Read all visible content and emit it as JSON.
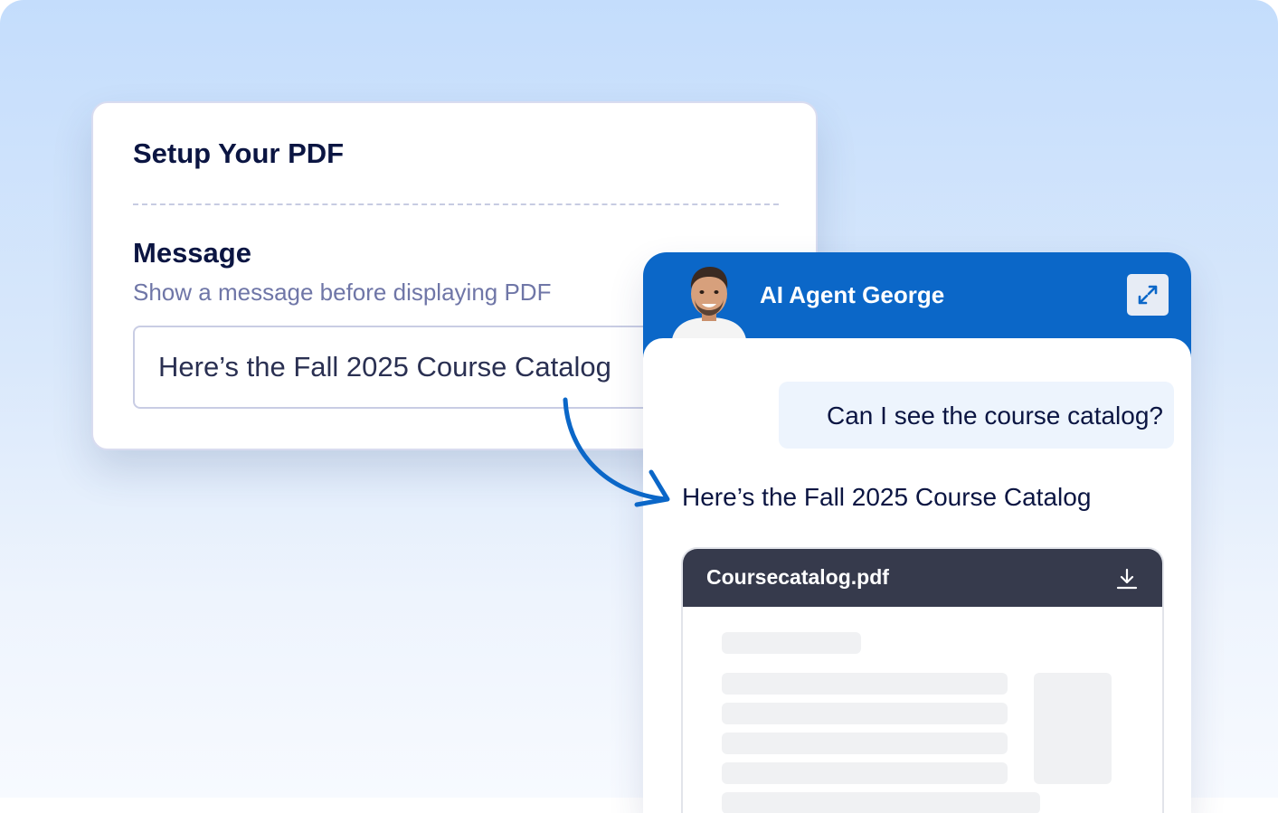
{
  "setup": {
    "title": "Setup Your PDF",
    "message_label": "Message",
    "message_description": "Show a message before displaying PDF",
    "message_value": "Here’s the Fall 2025 Course Catalog"
  },
  "chat": {
    "agent_name": "AI Agent George",
    "expand_icon": "expand-arrows-icon",
    "user_message": "Can I see the course catalog?",
    "bot_message": "Here’s the Fall 2025 Course Catalog",
    "attachment": {
      "filename": "Coursecatalog.pdf",
      "download_icon": "download-icon"
    }
  },
  "colors": {
    "accent": "#0b67c8",
    "heading": "#0b1542",
    "muted": "#6f76a7",
    "pdf_header": "#363a4c"
  }
}
